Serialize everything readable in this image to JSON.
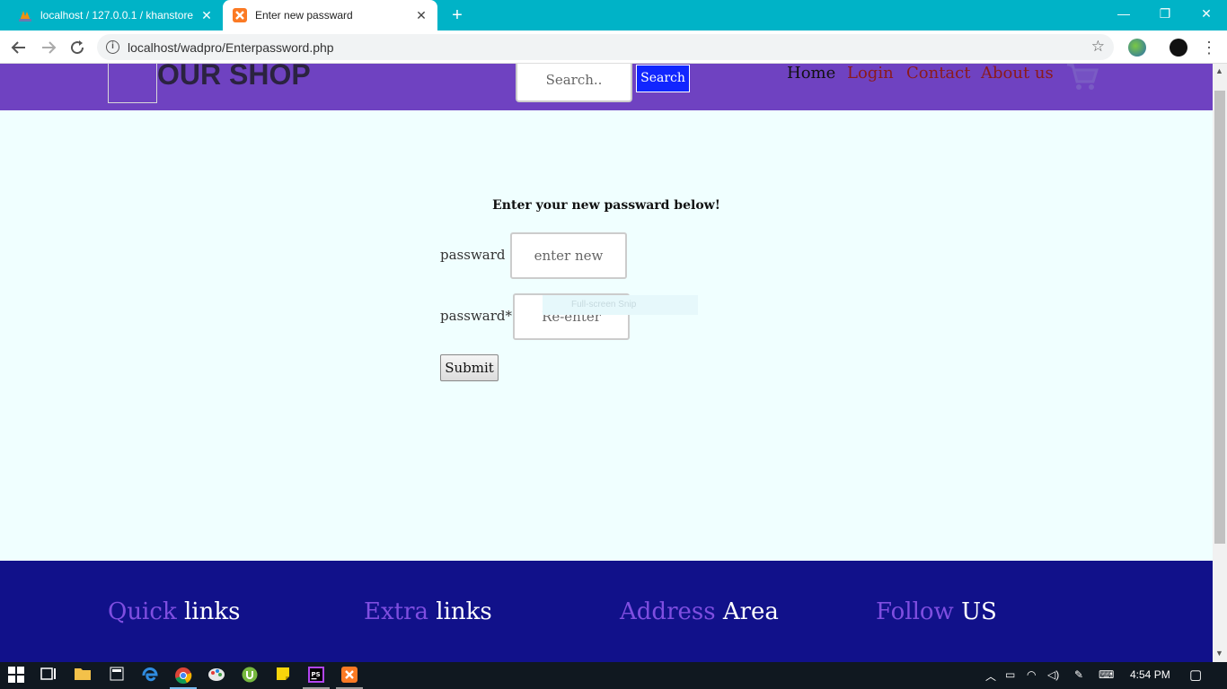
{
  "browser": {
    "tabs": [
      {
        "title": "localhost / 127.0.0.1 / khanstore",
        "close": "✕"
      },
      {
        "title": "Enter new passward",
        "close": "✕"
      }
    ],
    "new_tab": "+",
    "window_controls": {
      "minimize": "—",
      "restore": "❐",
      "close": "✕"
    },
    "url": "localhost/wadpro/Enterpassword.php"
  },
  "site": {
    "brand": "OUR SHOP",
    "search": {
      "placeholder": "Search..",
      "button": "Search"
    },
    "nav": {
      "home": "Home",
      "login": "Login",
      "contact": "Contact",
      "about": "About us"
    }
  },
  "form": {
    "title": "Enter your new passward below!",
    "password_label": "passward :",
    "password_placeholder": "enter new",
    "repassword_label": "passward*:",
    "repassword_placeholder": "Re-enter",
    "submit": "Submit",
    "overlay_text": "Full-screen Snip"
  },
  "footer": {
    "quick": {
      "accent": "Quick",
      "rest": " links"
    },
    "extra": {
      "accent": "Extra",
      "rest": " links"
    },
    "address": {
      "accent": "Address",
      "rest": " Area"
    },
    "follow": {
      "accent": "Follow",
      "rest": " US"
    }
  },
  "taskbar": {
    "time": "4:54 PM"
  },
  "colors": {
    "tabstrip": "#00b3c7",
    "header": "#6f42c1",
    "page_bg": "#f0ffff",
    "footer": "#11118a",
    "search_button": "#1126ff",
    "nav_link": "#8b1a1a"
  }
}
